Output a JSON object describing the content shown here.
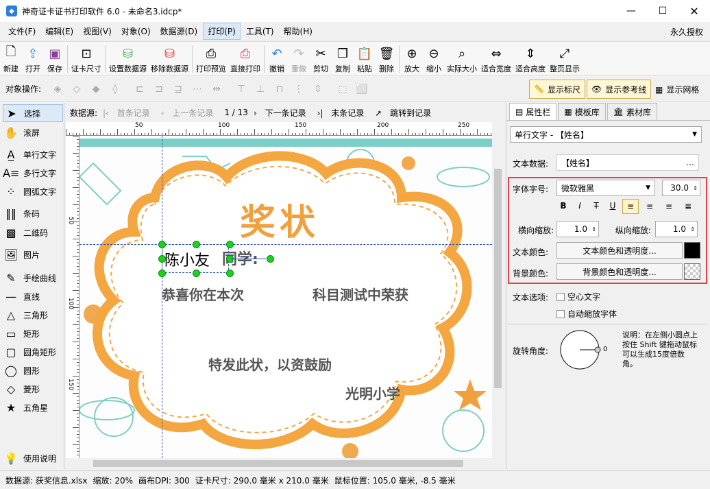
{
  "title": "神奇证卡证书打印软件 6.0 - 未命名3.idcp*",
  "menu": [
    "文件(F)",
    "编辑(E)",
    "视图(V)",
    "对象(O)",
    "数据源(D)",
    "打印(P)",
    "工具(T)",
    "帮助(H)"
  ],
  "auth": "永久授权",
  "toolbar": [
    {
      "label": "新建",
      "icon": "new-icon"
    },
    {
      "label": "打开",
      "icon": "open-icon"
    },
    {
      "label": "保存",
      "icon": "save-icon"
    },
    {
      "label": "证卡尺寸",
      "icon": "card-size-icon"
    },
    {
      "label": "设置数据源",
      "icon": "database-set-icon"
    },
    {
      "label": "移除数据源",
      "icon": "database-remove-icon"
    },
    {
      "label": "打印预览",
      "icon": "print-preview-icon"
    },
    {
      "label": "直接打印",
      "icon": "print-icon"
    },
    {
      "label": "撤销",
      "icon": "undo-icon"
    },
    {
      "label": "重做",
      "icon": "redo-icon"
    },
    {
      "label": "剪切",
      "icon": "cut-icon"
    },
    {
      "label": "复制",
      "icon": "copy-icon"
    },
    {
      "label": "粘贴",
      "icon": "paste-icon"
    },
    {
      "label": "删除",
      "icon": "delete-icon"
    },
    {
      "label": "放大",
      "icon": "zoom-in-icon"
    },
    {
      "label": "缩小",
      "icon": "zoom-out-icon"
    },
    {
      "label": "实际大小",
      "icon": "actual-size-icon"
    },
    {
      "label": "适合宽度",
      "icon": "fit-width-icon"
    },
    {
      "label": "适合高度",
      "icon": "fit-height-icon"
    },
    {
      "label": "整页显示",
      "icon": "fit-page-icon"
    }
  ],
  "objbar": {
    "label": "对象操作:",
    "show_ruler": "显示标尺",
    "show_guides": "显示参考线",
    "show_grid": "显示网格"
  },
  "tools": [
    "选择",
    "滚屏",
    "单行文字",
    "多行文字",
    "圆弧文字",
    "条码",
    "二维码",
    "图片",
    "手绘曲线",
    "直线",
    "三角形",
    "矩形",
    "圆角矩形",
    "圆形",
    "菱形",
    "五角星",
    "使用说明"
  ],
  "datasource": {
    "label": "数据源:",
    "first": "首条记录",
    "prev": "上一条记录",
    "count": "1 / 13",
    "next": "下一条记录",
    "last": "末条记录",
    "jump": "跳转到记录"
  },
  "ruler_h": [
    "50",
    "100",
    "150",
    "200",
    "250"
  ],
  "ruler_v": [
    "50",
    "100",
    "150"
  ],
  "canvas": {
    "title": "奖状",
    "line1_name": "陈小友",
    "line1_rest": "同学:",
    "line2a": "恭喜你在本次",
    "line2b": "科目测试中荣获",
    "line3": "特发此状，以资鼓励",
    "school": "光明小学"
  },
  "panel": {
    "tabs": [
      "属性栏",
      "模板库",
      "素材库"
    ],
    "object": "单行文字 - 【姓名】",
    "text_data_label": "文本数据:",
    "text_data": "【姓名】",
    "font_label": "字体字号:",
    "font": "微软雅黑",
    "size": "30.0",
    "hscale_label": "横向缩放:",
    "hscale": "1.0",
    "vscale_label": "纵向缩放:",
    "vscale": "1.0",
    "color_label": "文本颜色:",
    "color_btn": "文本颜色和透明度...",
    "bg_label": "背景颜色:",
    "bg_btn": "背景颜色和透明度...",
    "opt_label": "文本选项:",
    "hollow": "空心文字",
    "autoscale": "自动缩放字体",
    "rotate_label": "旋转角度:",
    "rotate_value": "0",
    "rotate_note": "说明：在左侧小圆点上按住 Shift 键拖动鼠标可以生成15度倍数角。"
  },
  "status": {
    "ds": "数据源: 获奖信息.xlsx",
    "zoom": "缩放: 20%",
    "dpi": "画布DPI: 300",
    "card": "证卡尺寸: 290.0 毫米 x 210.0 毫米",
    "mouse": "鼠标位置: 105.0 毫米, -8.5 毫米"
  },
  "colors": {
    "accent": "#f0a03c",
    "teal": "#7ccfc6",
    "red_box": "#e2434b"
  }
}
